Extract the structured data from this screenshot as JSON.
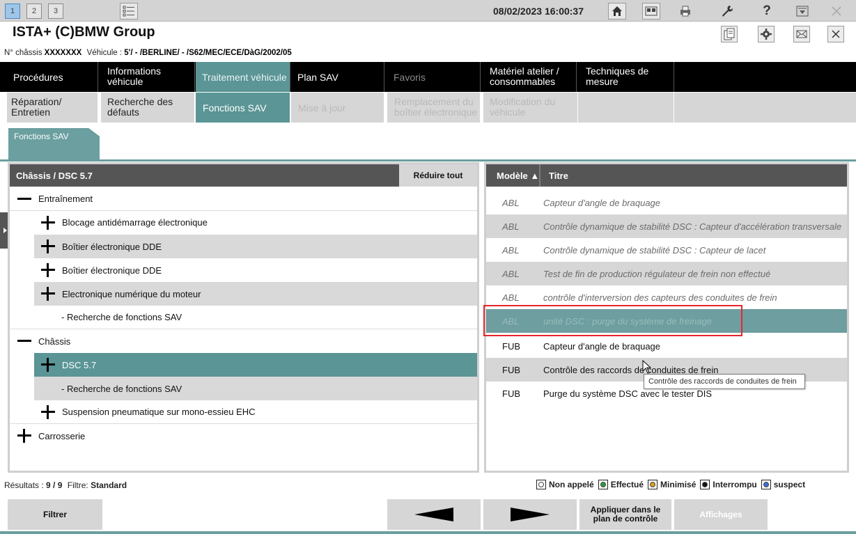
{
  "topbar": {
    "tabs": [
      "1",
      "2",
      "3"
    ],
    "datetime": "08/02/2023 16:00:37"
  },
  "title": "ISTA+ (C)BMW Group",
  "info": {
    "chassis_label": "N° châssis",
    "chassis_value": "XXXXXXX",
    "vehicle_label": "Véhicule :",
    "vehicle_value": "5'/ - /BERLINE/ - /S62/MEC/ECE/DàG/2002/05"
  },
  "nav1": [
    {
      "label": "Procédures"
    },
    {
      "label": "Informations véhicule"
    },
    {
      "label": "Traitement véhicule"
    },
    {
      "label": "Plan SAV"
    },
    {
      "label": "Favoris"
    },
    {
      "label": "Matériel atelier / consommables"
    },
    {
      "label": "Techniques de mesure"
    }
  ],
  "nav2": [
    {
      "label": "Réparation/ Entretien"
    },
    {
      "label": "Recherche des défauts"
    },
    {
      "label": "Fonctions SAV"
    },
    {
      "label": "Mise à jour"
    },
    {
      "label": "Remplacement du boîtier électronique"
    },
    {
      "label": "Modification du véhicule"
    }
  ],
  "tab": "Fonctions SAV",
  "tree": {
    "header": "Châssis / DSC 5.7",
    "collapse_all": "Réduire tout",
    "rows": [
      {
        "label": "Entraînement"
      },
      {
        "label": "Blocage antidémarrage électronique"
      },
      {
        "label": "Boîtier électronique DDE"
      },
      {
        "label": "Boîtier électronique DDE"
      },
      {
        "label": "Electronique numérique du moteur"
      },
      {
        "label": "- Recherche de fonctions SAV"
      },
      {
        "label": "Châssis"
      },
      {
        "label": "DSC 5.7"
      },
      {
        "label": "- Recherche de fonctions SAV"
      },
      {
        "label": "Suspension pneumatique sur mono-essieu EHC"
      },
      {
        "label": "Carrosserie"
      }
    ]
  },
  "list": {
    "col_model": "Modèle ▲",
    "col_title": "Titre",
    "rows": [
      {
        "model": "ABL",
        "title": "Capteur d'angle de braquage"
      },
      {
        "model": "ABL",
        "title": "Contrôle dynamique de stabilité DSC : Capteur d'accélération transversale"
      },
      {
        "model": "ABL",
        "title": "Contrôle dynamique de stabilité DSC : Capteur de lacet"
      },
      {
        "model": "ABL",
        "title": "Test de fin de production régulateur de frein non effectué"
      },
      {
        "model": "ABL",
        "title": "contrôle d'interversion des capteurs des conduites de frein"
      },
      {
        "model": "ABL",
        "title": "unité DSC : purge du système de freinage"
      },
      {
        "model": "FUB",
        "title": "Capteur d'angle de braquage"
      },
      {
        "model": "FUB",
        "title": "Contrôle des raccords de conduites de frein"
      },
      {
        "model": "FUB",
        "title": "Purge du système DSC avec le tester DIS"
      }
    ],
    "tooltip": "Contrôle des raccords de conduites de frein"
  },
  "status": {
    "results_label": "Résultats :",
    "results_value": "9 / 9",
    "filter_label": "Filtre:",
    "filter_value": "Standard"
  },
  "legend": [
    {
      "label": "Non appelé",
      "color": "#ffffff"
    },
    {
      "label": "Effectué",
      "color": "#2e9a3a"
    },
    {
      "label": "Minimisé",
      "color": "#d8a21c"
    },
    {
      "label": "Interrompu",
      "color": "#111111"
    },
    {
      "label": "suspect",
      "color": "#3c6fd8"
    }
  ],
  "buttons": {
    "filter": "Filtrer",
    "apply": "Appliquer dans le plan de contrôle",
    "displays": "Affichages"
  },
  "colors": {
    "accent": "#5b9596",
    "highlight_box": "#e5262a"
  }
}
